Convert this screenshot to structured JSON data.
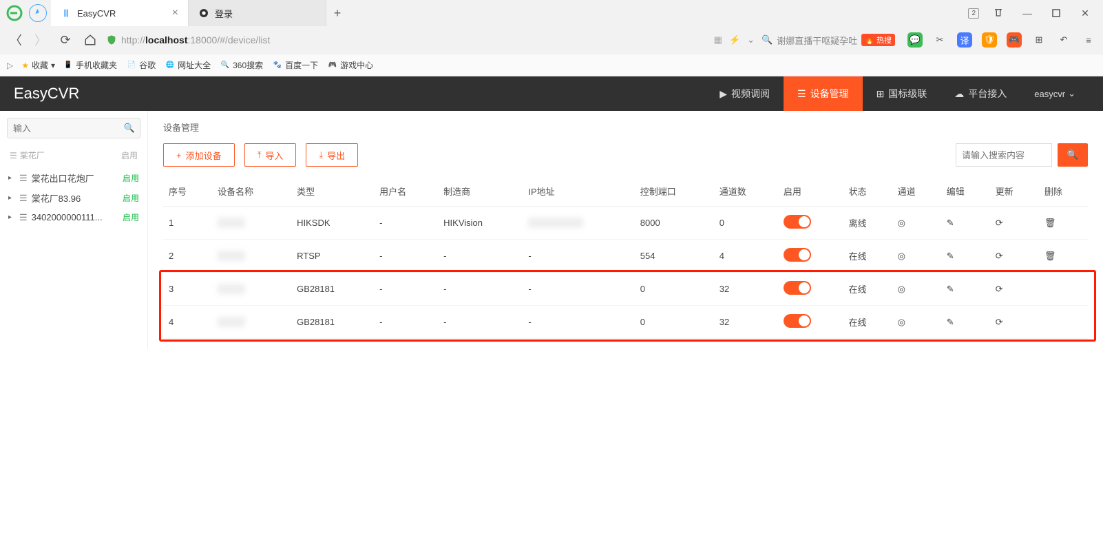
{
  "browser": {
    "tabs": [
      {
        "title": "EasyCVR",
        "active": true
      },
      {
        "title": "登录",
        "active": false
      }
    ],
    "url_pre": "http://",
    "url_host": "localhost",
    "url_port": ":18000",
    "url_path": "/#/device/list",
    "search_hint": "谢娜直播干呕疑孕吐",
    "hot_label": "热搜",
    "badge": "2"
  },
  "bookmarks": {
    "star": "收藏",
    "items": [
      "手机收藏夹",
      "谷歌",
      "网址大全",
      "360搜索",
      "百度一下",
      "游戏中心"
    ]
  },
  "header": {
    "title": "EasyCVR",
    "nav": [
      {
        "icon": "play",
        "label": "视频调阅"
      },
      {
        "icon": "list",
        "label": "设备管理",
        "active": true
      },
      {
        "icon": "grid",
        "label": "国标级联"
      },
      {
        "icon": "cloud",
        "label": "平台接入"
      }
    ],
    "user": "easycvr"
  },
  "sidebar": {
    "search_placeholder": "输入",
    "head_left": "棠花厂",
    "head_right": "启用",
    "items": [
      {
        "label": "棠花出口花炮厂",
        "status": "启用"
      },
      {
        "label": "棠花厂83.96",
        "status": "启用"
      },
      {
        "label": "3402000000111...",
        "status": "启用"
      }
    ]
  },
  "main": {
    "crumb": "设备管理",
    "btn_add": "添加设备",
    "btn_import": "导入",
    "btn_export": "导出",
    "search_placeholder": "请输入搜索内容",
    "columns": [
      "序号",
      "设备名称",
      "类型",
      "用户名",
      "制造商",
      "IP地址",
      "控制端口",
      "通道数",
      "启用",
      "状态",
      "通道",
      "编辑",
      "更新",
      "删除"
    ],
    "rows": [
      {
        "idx": "1",
        "name": "[blur]",
        "type": "HIKSDK",
        "user": "-",
        "vendor": "HIKVision",
        "ip": "[blur]",
        "port": "8000",
        "ch": "0",
        "status": "离线",
        "status_cls": "st-offline",
        "del": true
      },
      {
        "idx": "2",
        "name": "[blur]",
        "type": "RTSP",
        "user": "-",
        "vendor": "-",
        "ip": "-",
        "port": "554",
        "ch": "4",
        "status": "在线",
        "status_cls": "st-online",
        "del": true
      },
      {
        "idx": "3",
        "name": "[blur]",
        "type": "GB28181",
        "user": "-",
        "vendor": "-",
        "ip": "-",
        "port": "0",
        "ch": "32",
        "status": "在线",
        "status_cls": "st-online",
        "del": false,
        "hl": true
      },
      {
        "idx": "4",
        "name": "[blur]",
        "type": "GB28181",
        "user": "-",
        "vendor": "-",
        "ip": "-",
        "port": "0",
        "ch": "32",
        "status": "在线",
        "status_cls": "st-online",
        "del": false,
        "hl": true
      }
    ]
  }
}
